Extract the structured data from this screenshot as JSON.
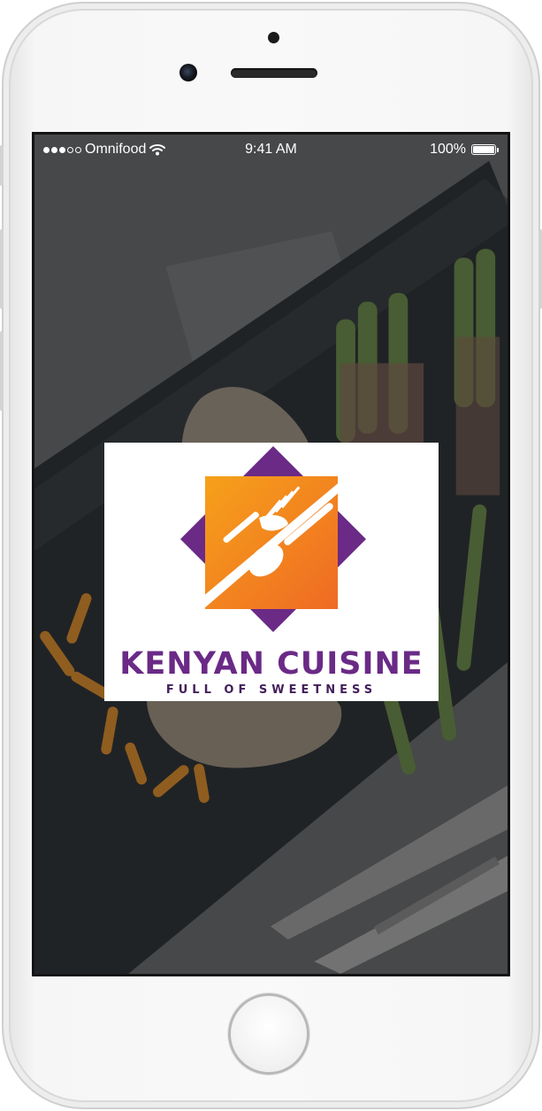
{
  "status_bar": {
    "signal_bars_filled": 3,
    "signal_bars_total": 5,
    "carrier": "Omnifood",
    "time": "9:41 AM",
    "battery_percent": "100%",
    "battery_level": 1.0
  },
  "splash": {
    "brand_name": "KENYAN CUISINE",
    "tagline": "FULL OF SWEETNESS"
  },
  "colors": {
    "logo_purple": "#6a2a86",
    "logo_orange": "#f27a1e",
    "logo_yellow": "#f6a11a",
    "screen_background": "#4c4c4c"
  },
  "icons": [
    "wifi-icon",
    "battery-icon",
    "fork-icon",
    "spoon-icon"
  ]
}
